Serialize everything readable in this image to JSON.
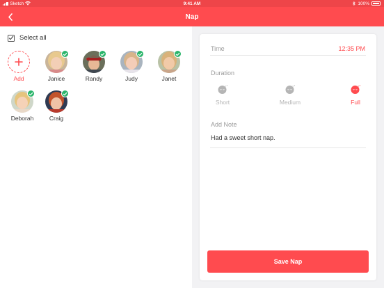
{
  "status_bar": {
    "carrier": "Sketch",
    "time": "9:41 AM",
    "battery": "100%"
  },
  "nav": {
    "title": "Nap"
  },
  "left_panel": {
    "select_all_label": "Select all",
    "add_label": "Add",
    "children": [
      {
        "name": "Janice",
        "selected": true
      },
      {
        "name": "Randy",
        "selected": true
      },
      {
        "name": "Judy",
        "selected": true
      },
      {
        "name": "Janet",
        "selected": true
      },
      {
        "name": "Deborah",
        "selected": true
      },
      {
        "name": "Craig",
        "selected": true
      }
    ]
  },
  "form": {
    "time_label": "Time",
    "time_value": "12:35 PM",
    "duration_label": "Duration",
    "duration_options": [
      {
        "label": "Short",
        "active": false
      },
      {
        "label": "Medium",
        "active": false
      },
      {
        "label": "Full",
        "active": true
      }
    ],
    "note_label": "Add Note",
    "note_value": "Had a sweet short nap.",
    "save_label": "Save Nap"
  },
  "colors": {
    "accent": "#ff4b4f",
    "check": "#2bb56b",
    "muted": "#b5b5b5"
  }
}
